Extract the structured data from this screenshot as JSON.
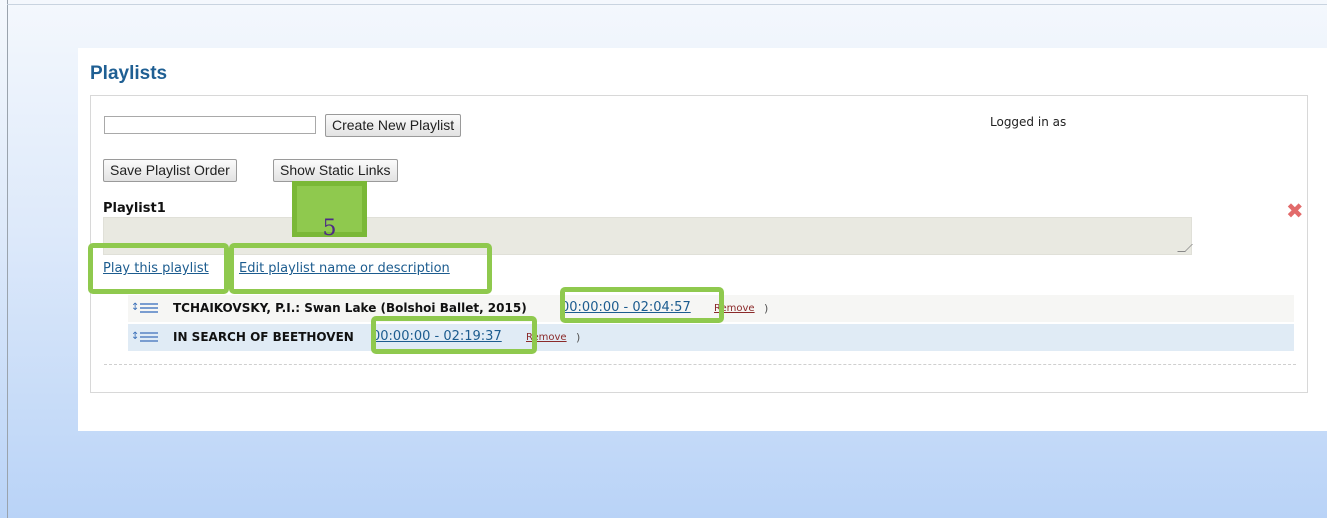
{
  "page": {
    "title": "Playlists",
    "logged_in": "Logged in as"
  },
  "controls": {
    "new_playlist_placeholder": "",
    "create_button": "Create New Playlist",
    "save_order_button": "Save Playlist Order",
    "static_links_button": "Show Static Links"
  },
  "playlist": {
    "name": "Playlist1",
    "description": "",
    "play_link": "Play this playlist",
    "edit_link": "Edit playlist name or description",
    "delete_icon": "close-x-icon",
    "items": [
      {
        "title": "TCHAIKOVSKY, P.I.: Swan Lake (Bolshoi Ballet, 2015)",
        "time": "00:00:00 - 02:04:57",
        "remove": "Remove",
        "close_paren": ")"
      },
      {
        "title": "IN SEARCH OF BEETHOVEN",
        "time": "00:00:00 - 02:19:37",
        "remove": "Remove",
        "close_paren": ")"
      }
    ]
  },
  "annotation": {
    "step_number": "5",
    "highlight_color": "#8fc94e"
  },
  "colors": {
    "title": "#1f5f93",
    "link": "#1c5c8f",
    "remove": "#8b2a2a",
    "delete": "#e26a6a"
  }
}
